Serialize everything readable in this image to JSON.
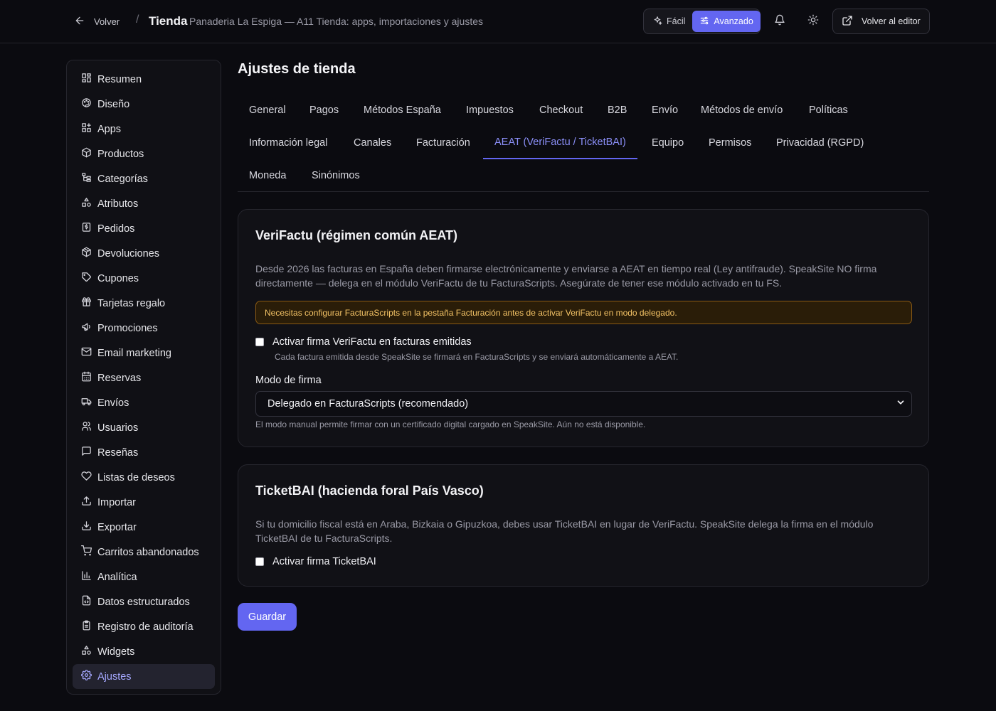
{
  "header": {
    "back_label": "Volver",
    "separator": "/",
    "title": "Tienda",
    "subtitle": "Panaderia La Espiga — A11 Tienda: apps, importaciones y ajustes",
    "mode_easy": "Fácil",
    "mode_advanced": "Avanzado",
    "editor_label": "Volver al editor"
  },
  "sidebar": {
    "items": [
      {
        "label": "Resumen",
        "icon": "dashboard-icon"
      },
      {
        "label": "Diseño",
        "icon": "palette-icon"
      },
      {
        "label": "Apps",
        "icon": "apps-icon"
      },
      {
        "label": "Productos",
        "icon": "package-icon"
      },
      {
        "label": "Categorías",
        "icon": "tree-icon"
      },
      {
        "label": "Atributos",
        "icon": "shapes-icon"
      },
      {
        "label": "Pedidos",
        "icon": "receipt-icon"
      },
      {
        "label": "Devoluciones",
        "icon": "package-return-icon"
      },
      {
        "label": "Cupones",
        "icon": "tag-icon"
      },
      {
        "label": "Tarjetas regalo",
        "icon": "gift-icon"
      },
      {
        "label": "Promociones",
        "icon": "megaphone-icon"
      },
      {
        "label": "Email marketing",
        "icon": "mail-icon"
      },
      {
        "label": "Reservas",
        "icon": "calendar-icon"
      },
      {
        "label": "Envíos",
        "icon": "truck-icon"
      },
      {
        "label": "Usuarios",
        "icon": "users-icon"
      },
      {
        "label": "Reseñas",
        "icon": "message-icon"
      },
      {
        "label": "Listas de deseos",
        "icon": "heart-icon"
      },
      {
        "label": "Importar",
        "icon": "upload-icon"
      },
      {
        "label": "Exportar",
        "icon": "download-icon"
      },
      {
        "label": "Carritos abandonados",
        "icon": "cart-icon"
      },
      {
        "label": "Analítica",
        "icon": "bar-chart-icon"
      },
      {
        "label": "Datos estructurados",
        "icon": "file-code-icon"
      },
      {
        "label": "Registro de auditoría",
        "icon": "clipboard-icon"
      },
      {
        "label": "Widgets",
        "icon": "widgets-icon"
      },
      {
        "label": "Ajustes",
        "icon": "gear-icon",
        "active": true
      }
    ]
  },
  "main": {
    "title": "Ajustes de tienda",
    "tabs": [
      "General",
      "Pagos",
      "Métodos España",
      "Impuestos",
      "Checkout",
      "B2B",
      "Envío",
      "Métodos de envío",
      "Políticas",
      "Información legal",
      "Canales",
      "Facturación",
      "AEAT (VeriFactu / TicketBAI)",
      "Equipo",
      "Permisos",
      "Privacidad (RGPD)",
      "Moneda",
      "Sinónimos"
    ],
    "active_tab": "AEAT (VeriFactu / TicketBAI)",
    "verifactu": {
      "title": "VeriFactu (régimen común AEAT)",
      "description": "Desde 2026 las facturas en España deben firmarse electrónicamente y enviarse a AEAT en tiempo real (Ley antifraude). SpeakSite NO firma directamente — delega en el módulo VeriFactu de tu FacturaScripts. Asegúrate de tener ese módulo activado en tu FS.",
      "alert": "Necesitas configurar FacturaScripts en la pestaña Facturación antes de activar VeriFactu en modo delegado.",
      "checkbox_label": "Activar firma VeriFactu en facturas emitidas",
      "checkbox_help": "Cada factura emitida desde SpeakSite se firmará en FacturaScripts y se enviará automáticamente a AEAT.",
      "mode_label": "Modo de firma",
      "mode_value": "Delegado en FacturaScripts (recomendado)",
      "mode_help": "El modo manual permite firmar con un certificado digital cargado en SpeakSite. Aún no está disponible."
    },
    "ticketbai": {
      "title": "TicketBAI (hacienda foral País Vasco)",
      "description": "Si tu domicilio fiscal está en Araba, Bizkaia o Gipuzkoa, debes usar TicketBAI en lugar de VeriFactu. SpeakSite delega la firma en el módulo TicketBAI de tu FacturaScripts.",
      "checkbox_label": "Activar firma TicketBAI"
    },
    "save_label": "Guardar"
  },
  "colors": {
    "accent": "#6366f1",
    "active_tab_text": "#8b8ff8",
    "alert_border": "#8a5a14",
    "alert_text": "#f3c265"
  }
}
